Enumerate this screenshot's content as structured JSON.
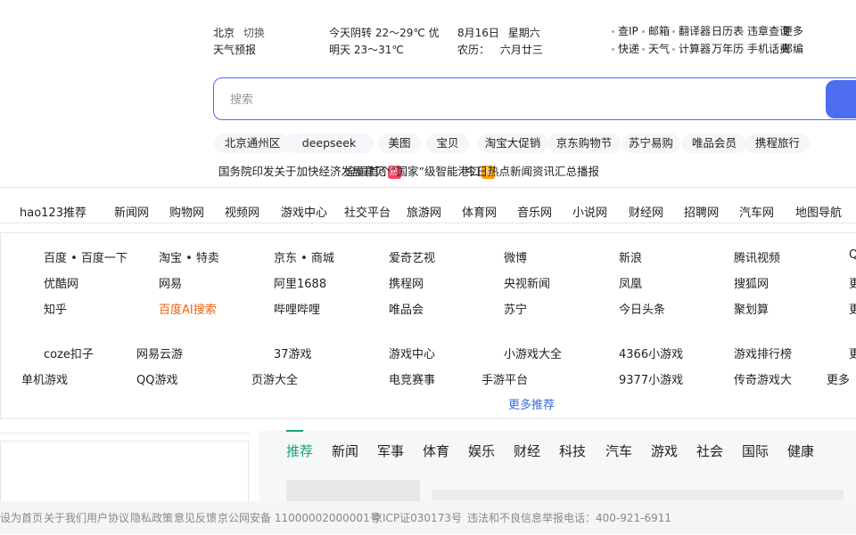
{
  "header": {
    "city": "北京",
    "city_switch": "切换",
    "weather_forecast": "天气预报",
    "today": "今天阴转 22～29℃",
    "today_extra": "优",
    "tomorrow": "明天 23～31℃",
    "date": "8月16日",
    "weekday": "星期六",
    "lunar": "六月廿三",
    "lunar_label": "农历：",
    "quick_links": [
      [
        "查IP",
        "邮箱",
        "翻译器",
        "日历表",
        "违章查询",
        "更多"
      ],
      [
        "快递",
        "天气",
        "计算器",
        "万年历",
        "手机话费",
        "邮编"
      ]
    ]
  },
  "search": {
    "placeholder": "搜索"
  },
  "hot": [
    "北京通州区",
    "deepseek",
    "美图",
    "宝贝",
    "淘宝大促销",
    "京东购物节",
    "苏宁易购",
    "唯品会员",
    "携程旅行"
  ],
  "news": [
    {
      "text": "国务院印发关于加快经济发展意见",
      "badge": "热",
      "color": "#f04a64"
    },
    {
      "text": "全国首个“国家”级智能港口",
      "badge": "新",
      "color": "#ff9b00"
    },
    {
      "text": "今日热点新闻资讯汇总播报"
    }
  ],
  "nav": [
    "hao123推荐",
    "新闻网",
    "购物网",
    "视频网",
    "游戏中心",
    "社交平台",
    "旅游网",
    "体育网",
    "音乐网",
    "小说网",
    "财经网",
    "招聘网",
    "汽车网",
    "地图导航"
  ],
  "sites": {
    "row1": [
      "百度 • 百度一下",
      "淘宝 • 特卖",
      "京东 • 商城",
      "爱奇艺视",
      "微博",
      "新浪",
      "腾讯视频",
      "Q"
    ],
    "row2": [
      "优酷网",
      "网易",
      "阿里1688",
      "携程网",
      "央视新闻",
      "凤凰",
      "搜狐网",
      "更"
    ],
    "row3": [
      "知乎",
      "百度AI搜索",
      "哔哩哔哩",
      "唯品会",
      "苏宁",
      "今日头条",
      "聚划算",
      "更"
    ],
    "row4": [
      "coze扣子",
      "网易云游",
      "37游戏",
      "游戏中心",
      "小游戏大全",
      "4366小游戏",
      "游戏排行榜",
      "更"
    ],
    "row5": [
      "单机游戏",
      "QQ游戏",
      "页游大全",
      "电竞赛事",
      "手游平台",
      "9377小游戏",
      "传奇游戏大",
      "更多"
    ],
    "orange_site": "百度AI搜索",
    "more": "更多推荐"
  },
  "tabs": [
    "推荐",
    "新闻",
    "军事",
    "体育",
    "娱乐",
    "财经",
    "科技",
    "汽车",
    "游戏",
    "社会",
    "国际",
    "健康"
  ],
  "footer": [
    "设为首页",
    "关于我们",
    "用户协议",
    "隐私政策",
    "意见反馈",
    "京公网安备 11000002000001号",
    "京ICP证030173号",
    "违法和不良信息举报电话：400-921-6911"
  ]
}
